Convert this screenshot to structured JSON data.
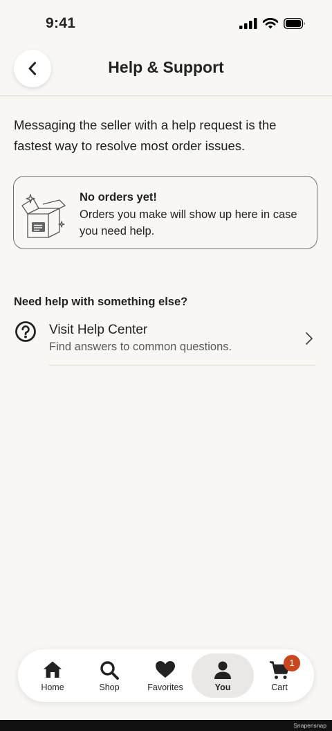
{
  "status_bar": {
    "time": "9:41"
  },
  "header": {
    "title": "Help & Support"
  },
  "intro": {
    "text": "Messaging the seller with a help request is the fastest way to resolve most order issues."
  },
  "empty_state": {
    "title": "No orders yet!",
    "text": "Orders you make will show up here in case you need help."
  },
  "help_section": {
    "heading": "Need help with something else?",
    "item_title": "Visit Help Center",
    "item_subtitle": "Find answers to common questions."
  },
  "tab_bar": {
    "tabs": [
      {
        "label": "Home",
        "icon": "home-icon"
      },
      {
        "label": "Shop",
        "icon": "search-icon"
      },
      {
        "label": "Favorites",
        "icon": "heart-icon"
      },
      {
        "label": "You",
        "icon": "person-icon",
        "active": true
      },
      {
        "label": "Cart",
        "icon": "cart-icon",
        "badge": "1"
      }
    ]
  },
  "watermark": "Snapensnap",
  "colors": {
    "background": "#f8f7f4",
    "badge": "#c9471f",
    "text": "#222222",
    "active_tab": "#e9e8e4"
  }
}
